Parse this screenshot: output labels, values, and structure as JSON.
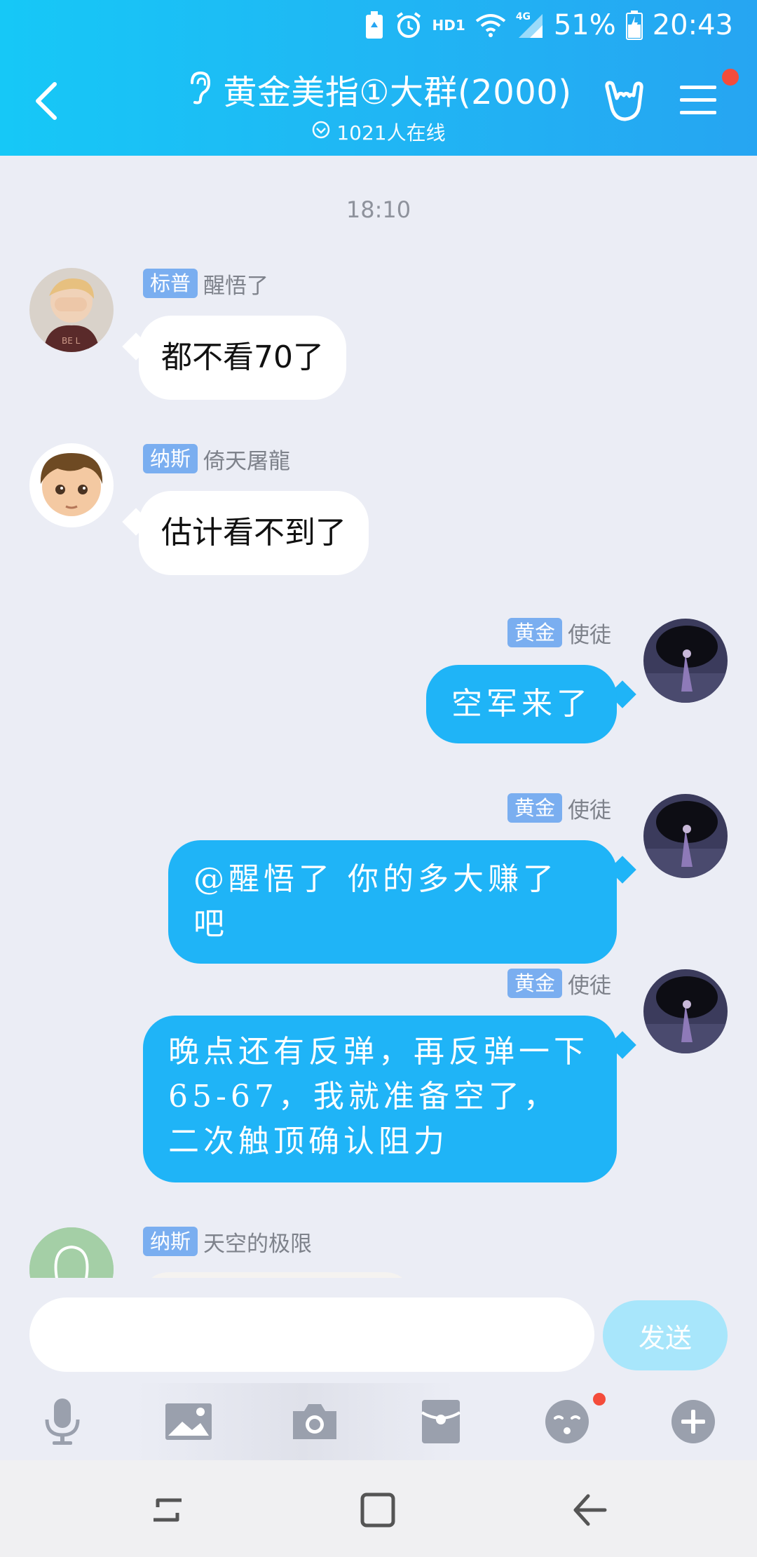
{
  "status_bar": {
    "network_label": "HD1",
    "signal_label": "4G",
    "battery": "51%",
    "time": "20:43"
  },
  "header": {
    "title": "黄金美指①大群(2000)",
    "online": "1021人在线"
  },
  "chat": {
    "timestamp": "18:10",
    "messages": [
      {
        "badge": "标普",
        "sender": "醒悟了",
        "text": "都不看70了"
      },
      {
        "badge": "纳斯",
        "sender": "倚天屠龍",
        "text": "估计看不到了"
      },
      {
        "badge": "黄金",
        "sender": "使徒",
        "text": "空军来了"
      },
      {
        "badge": "黄金",
        "sender": "使徒",
        "text": "@醒悟了 你的多大赚了吧"
      },
      {
        "badge": "黄金",
        "sender": "使徒",
        "text": "晚点还有反弹，再反弹一下65-67，我就准备空了，二次触顶确认阻力"
      },
      {
        "badge": "纳斯",
        "sender": "天空的极限",
        "text": ""
      }
    ]
  },
  "input": {
    "placeholder": "",
    "send_label": "发送"
  },
  "toolbar": {
    "icons": [
      "microphone-icon",
      "image-icon",
      "camera-icon",
      "red-packet-icon",
      "emoji-icon",
      "plus-icon"
    ]
  },
  "colors": {
    "header_start": "#16c8f7",
    "header_end": "#26a5f2",
    "outgoing_bubble": "#1fb4f7",
    "badge": "#7aaef0",
    "notification_dot": "#f44c3b",
    "background": "#ebedf5"
  }
}
